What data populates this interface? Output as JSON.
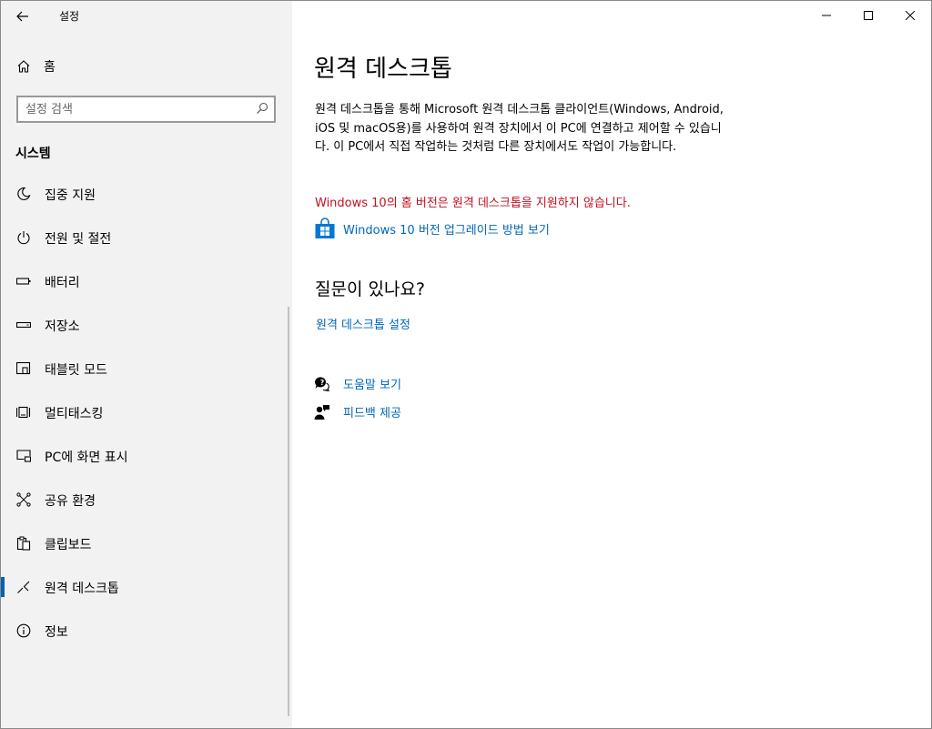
{
  "app": {
    "title": "설정"
  },
  "window_controls": {
    "minimize": "minimize-icon",
    "maximize": "maximize-icon",
    "close": "close-icon"
  },
  "sidebar": {
    "home_label": "홈",
    "search": {
      "placeholder": "설정 검색",
      "value": ""
    },
    "section_title": "시스템",
    "items": [
      {
        "label": "집중 지원",
        "icon": "moon-icon",
        "active": false
      },
      {
        "label": "전원 및 절전",
        "icon": "power-icon",
        "active": false
      },
      {
        "label": "배터리",
        "icon": "battery-icon",
        "active": false
      },
      {
        "label": "저장소",
        "icon": "storage-icon",
        "active": false
      },
      {
        "label": "태블릿 모드",
        "icon": "tablet-icon",
        "active": false
      },
      {
        "label": "멀티태스킹",
        "icon": "multitasking-icon",
        "active": false
      },
      {
        "label": "PC에 화면 표시",
        "icon": "project-icon",
        "active": false
      },
      {
        "label": "공유 환경",
        "icon": "shared-experiences-icon",
        "active": false
      },
      {
        "label": "클립보드",
        "icon": "clipboard-icon",
        "active": false
      },
      {
        "label": "원격 데스크톱",
        "icon": "remote-desktop-icon",
        "active": true
      },
      {
        "label": "정보",
        "icon": "info-icon",
        "active": false
      }
    ]
  },
  "main": {
    "title": "원격 데스크톱",
    "description": "원격 데스크톱을 통해 Microsoft 원격 데스크톱 클라이언트(Windows, Android, iOS 및 macOS용)를 사용하여 원격 장치에서 이 PC에 연결하고 제어할 수 있습니다. 이 PC에서 직접 작업하는 것처럼 다른 장치에서도 작업이 가능합니다.",
    "warning": "Windows 10의 홈 버전은 원격 데스크톱을 지원하지 않습니다.",
    "upgrade_link": "Windows 10 버전 업그레이드 방법 보기",
    "qa_title": "질문이 있나요?",
    "rd_settings_link": "원격 데스크톱 설정",
    "help_link": "도움말 보기",
    "feedback_link": "피드백 제공"
  },
  "colors": {
    "accent": "#0067b8",
    "warning": "#c50f1f",
    "sidebar_bg": "#f2f2f2",
    "active_indicator": "#0063b1"
  }
}
